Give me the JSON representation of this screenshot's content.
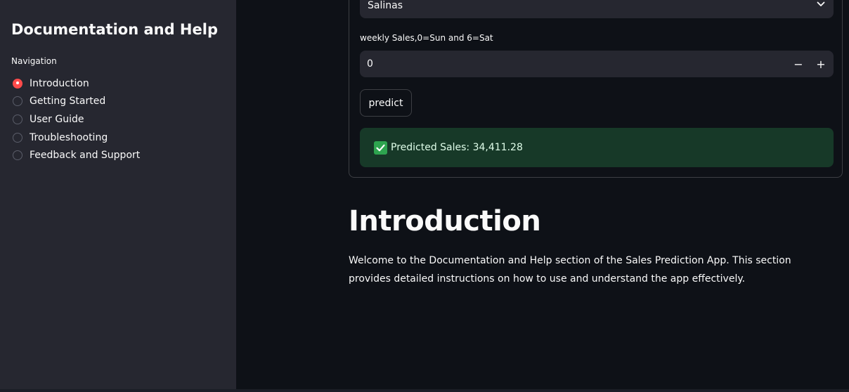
{
  "sidebar": {
    "title": "Documentation and Help",
    "nav_label": "Navigation",
    "items": [
      {
        "label": "Introduction",
        "selected": true
      },
      {
        "label": "Getting Started",
        "selected": false
      },
      {
        "label": "User Guide",
        "selected": false
      },
      {
        "label": "Troubleshooting",
        "selected": false
      },
      {
        "label": "Feedback and Support",
        "selected": false
      }
    ]
  },
  "form": {
    "store_select": {
      "value": "Salinas",
      "icon": "chevron-down-icon"
    },
    "day_field": {
      "label": "weekly Sales,0=Sun and 6=Sat",
      "value": "0",
      "minus": "−",
      "plus": "+"
    },
    "predict_label": "predict",
    "result": {
      "text": "Predicted Sales: 34,411.28",
      "icon": "check-icon"
    }
  },
  "main": {
    "heading": "Introduction",
    "paragraph": "Welcome to the Documentation and Help section of the Sales Prediction App. This section provides detailed instructions on how to use and understand the app effectively."
  },
  "colors": {
    "background": "#0e1117",
    "sidebar": "#262730",
    "accent": "#ff4b4b",
    "success_bg": "#173928",
    "success_icon": "#2ea44f"
  }
}
